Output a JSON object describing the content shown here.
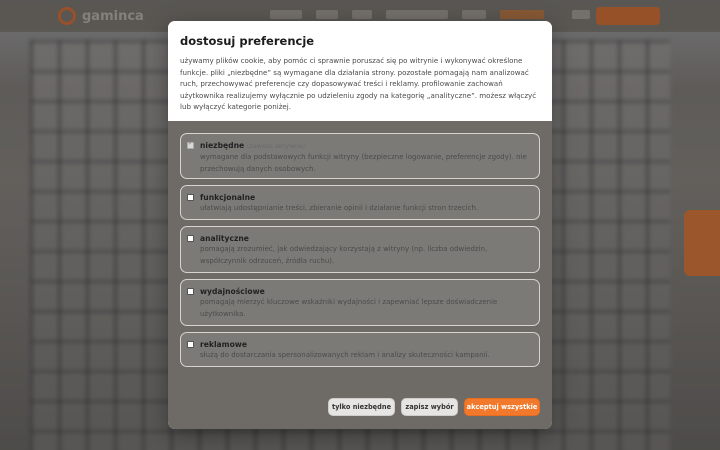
{
  "site": {
    "logo_text": "gaminca"
  },
  "modal": {
    "title": "dostosuj preferencje",
    "description": "używamy plików cookie, aby pomóc ci sprawnie poruszać się po witrynie i wykonywać określone funkcje. pliki „niezbędne” są wymagane dla działania strony. pozostałe pomagają nam analizować ruch, przechowywać preferencje czy dopasowywać treści i reklamy. profilowanie zachowań użytkownika realizujemy wyłącznie po udzieleniu zgody na kategorię „analityczne”. możesz włączyć lub wyłączyć kategorie poniżej.",
    "options": [
      {
        "title": "niezbędne",
        "note": "(zawsze aktywne)",
        "description": "wymagane dla podstawowych funkcji witryny (bezpieczne logowanie, preferencje zgody). nie przechowują danych osobowych.",
        "checked": true,
        "disabled": true
      },
      {
        "title": "funkcjonalne",
        "note": "",
        "description": "ułatwiają udostępnianie treści, zbieranie opinii i działanie funkcji stron trzecich.",
        "checked": false,
        "disabled": false
      },
      {
        "title": "analityczne",
        "note": "",
        "description": "pomagają zrozumieć, jak odwiedzający korzystają z witryny (np. liczba odwiedzin, współczynnik odrzuceń, źródła ruchu).",
        "checked": false,
        "disabled": false
      },
      {
        "title": "wydajnościowe",
        "note": "",
        "description": "pomagają mierzyć kluczowe wskaźniki wydajności i zapewniać lepsze doświadczenie użytkownika.",
        "checked": false,
        "disabled": false
      },
      {
        "title": "reklamowe",
        "note": "",
        "description": "służą do dostarczania spersonalizowanych reklam i analizy skuteczności kampanii.",
        "checked": false,
        "disabled": false
      }
    ],
    "buttons": {
      "necessary_only": "tylko niezbędne",
      "save_choice": "zapisz wybór",
      "accept_all": "akceptuj wszystkie"
    },
    "colors": {
      "accent": "#f2792b",
      "panel_bg": "#ffffff"
    }
  }
}
